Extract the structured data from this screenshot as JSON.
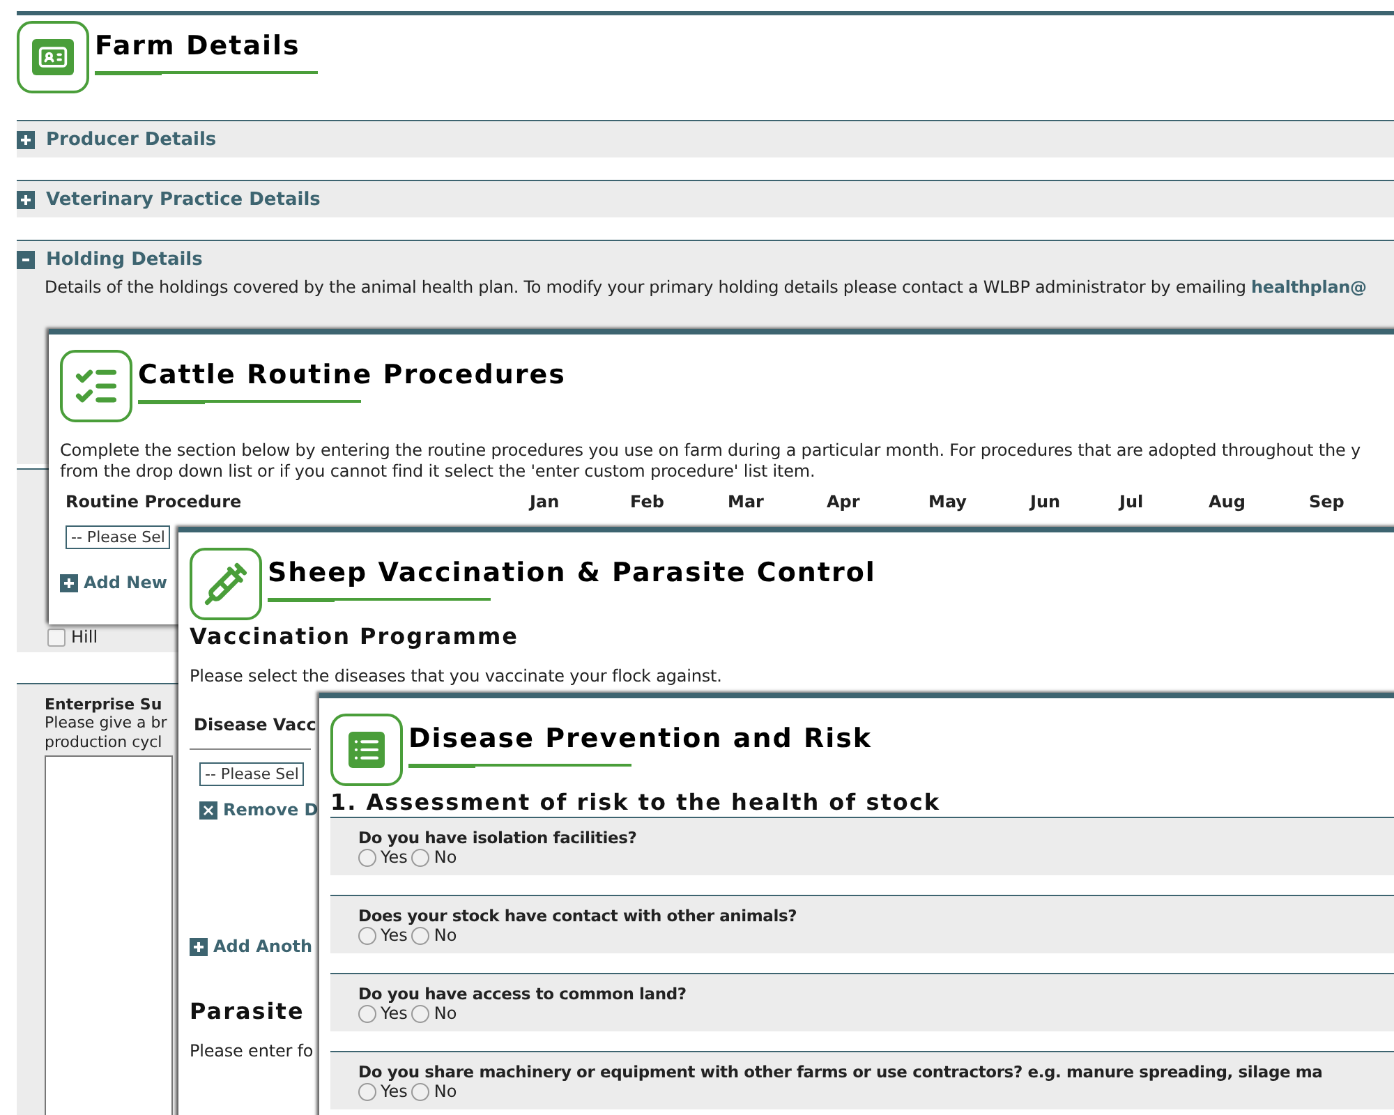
{
  "farm_details": {
    "title": "Farm Details",
    "sections": [
      {
        "label": "Producer Details",
        "expanded": false
      },
      {
        "label": "Veterinary Practice Details",
        "expanded": false
      },
      {
        "label": "Holding Details",
        "expanded": true,
        "description": "Details of the holdings covered by the animal health plan. To modify your primary holding details please contact a WLBP administrator by emailing ",
        "link": "healthplan@"
      }
    ],
    "hill_checkbox": {
      "label": "Hill",
      "checked": false
    },
    "enterprise": {
      "label": "Enterprise Su",
      "hint_lines": [
        "Please give a br",
        "production cycl"
      ]
    }
  },
  "cattle_routine_procedures": {
    "title": "Cattle Routine Procedures",
    "description_lines": [
      "Complete the section below by entering the routine procedures you use on farm during a particular month. For procedures that are adopted throughout the y",
      "from the drop down list or if you cannot find it select the 'enter custom procedure' list item."
    ],
    "columns": [
      "Routine Procedure",
      "Jan",
      "Feb",
      "Mar",
      "Apr",
      "May",
      "Jun",
      "Jul",
      "Aug",
      "Sep"
    ],
    "select": {
      "value": "-- Please Sel"
    },
    "add_button": "Add New"
  },
  "sheep_vaccination": {
    "title": "Sheep Vaccination & Parasite Control",
    "heading": "Vaccination Programme",
    "description": "Please select the diseases that you vaccinate your flock against.",
    "column": "Disease Vacc",
    "select": {
      "value": "-- Please Sel"
    },
    "remove_button": "Remove D",
    "add_button": "Add Anoth",
    "parasite_heading": "Parasite",
    "parasite_description": "Please enter fo"
  },
  "disease_prevention": {
    "title": "Disease Prevention and Risk",
    "heading": "1. Assessment of risk to the health of stock",
    "questions": [
      {
        "text": "Do you have isolation facilities?",
        "options": [
          {
            "label": "Yes",
            "selected": false
          },
          {
            "label": "No",
            "selected": false
          }
        ]
      },
      {
        "text": "Does your stock have contact with other animals?",
        "options": [
          {
            "label": "Yes",
            "selected": false
          },
          {
            "label": "No",
            "selected": false
          }
        ]
      },
      {
        "text": "Do you have access to common land?",
        "options": [
          {
            "label": "Yes",
            "selected": false
          },
          {
            "label": "No",
            "selected": false
          }
        ]
      },
      {
        "text": "Do you share machinery or equipment with other farms or use contractors? e.g. manure spreading, silage ma",
        "options": [
          {
            "label": "Yes",
            "selected": false
          },
          {
            "label": "No",
            "selected": false
          }
        ]
      }
    ]
  }
}
